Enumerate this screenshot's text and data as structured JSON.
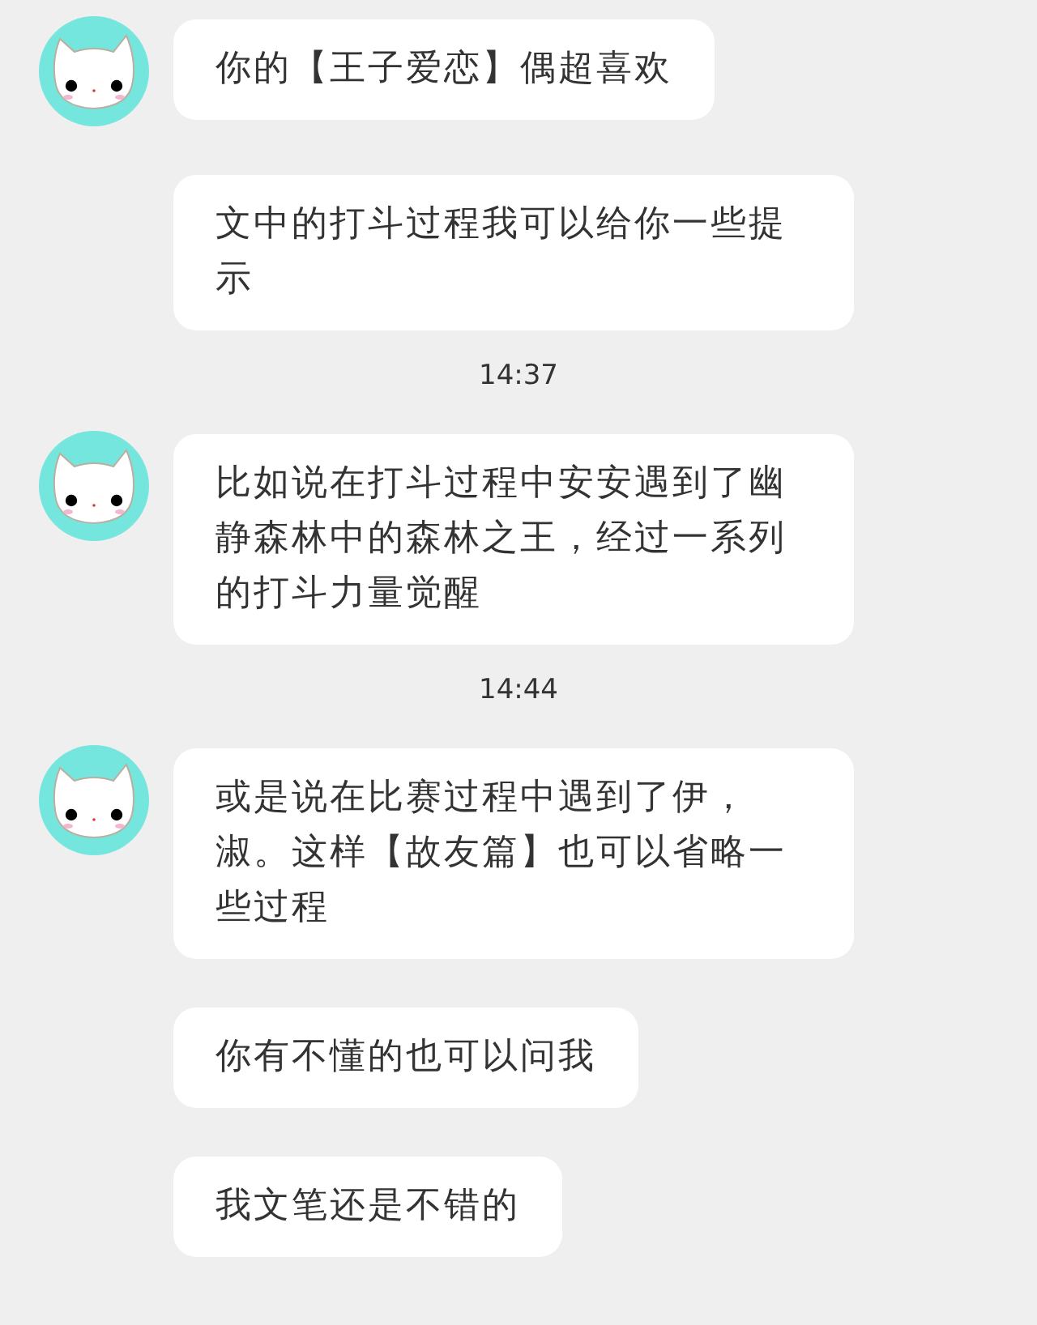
{
  "messages": [
    {
      "kind": "message",
      "avatar": true,
      "text": "你的【王子爱恋】偶超喜欢"
    },
    {
      "kind": "message",
      "avatar": false,
      "text": "文中的打斗过程我可以给你一些提示"
    },
    {
      "kind": "time",
      "text": "14:37"
    },
    {
      "kind": "message",
      "avatar": true,
      "text": "比如说在打斗过程中安安遇到了幽静森林中的森林之王，经过一系列的打斗力量觉醒"
    },
    {
      "kind": "time",
      "text": "14:44"
    },
    {
      "kind": "message",
      "avatar": true,
      "text": "或是说在比赛过程中遇到了伊，淑。这样【故友篇】也可以省略一些过程"
    },
    {
      "kind": "message",
      "avatar": false,
      "text": "你有不懂的也可以问我"
    },
    {
      "kind": "message",
      "avatar": false,
      "text": "我文笔还是不错的"
    }
  ]
}
